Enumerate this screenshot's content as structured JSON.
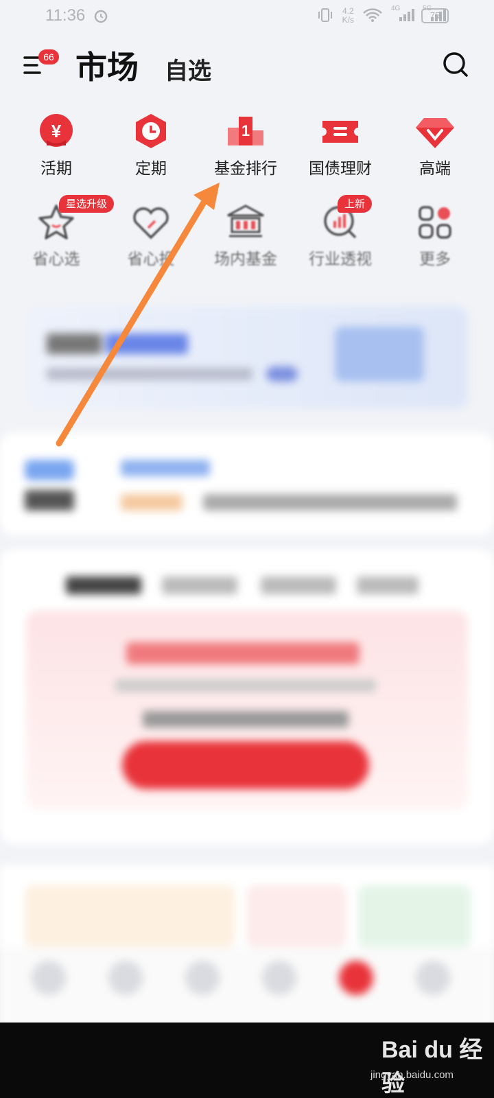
{
  "status_bar": {
    "time": "11:36",
    "net_speed_value": "4.2",
    "net_speed_unit": "K/s",
    "signal1": "4G",
    "signal2": "5G",
    "battery": "75"
  },
  "header": {
    "menu_badge": "66",
    "title": "市场",
    "watchlist_tab": "自选"
  },
  "quick_entries_row1": [
    {
      "label": "活期",
      "icon": "yen-icon"
    },
    {
      "label": "定期",
      "icon": "clock-icon"
    },
    {
      "label": "基金排行",
      "icon": "podium-icon"
    },
    {
      "label": "国债理财",
      "icon": "ticket-icon"
    },
    {
      "label": "高端",
      "icon": "diamond-icon"
    }
  ],
  "quick_entries_row2": [
    {
      "label": "省心选",
      "icon": "star-icon",
      "tag": "星选升级"
    },
    {
      "label": "省心投",
      "icon": "heart-icon"
    },
    {
      "label": "场内基金",
      "icon": "exchange-icon"
    },
    {
      "label": "行业透视",
      "icon": "magnifier-chart-icon",
      "tag": "上新"
    },
    {
      "label": "更多",
      "icon": "grid-icon"
    }
  ],
  "watermark": {
    "logo": "Bai du 经验",
    "url": "jingyan.baidu.com"
  },
  "colors": {
    "accent": "#e8333a",
    "arrow": "#f5883a"
  }
}
